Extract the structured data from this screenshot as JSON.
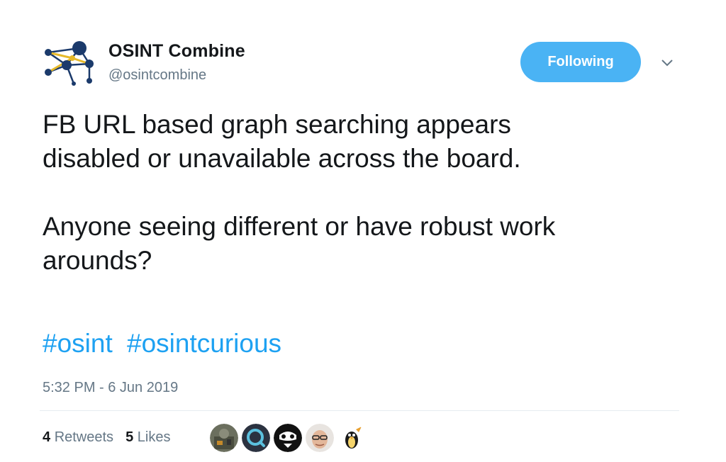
{
  "account": {
    "name": "OSINT Combine",
    "handle": "@osintcombine"
  },
  "follow_button": {
    "label": "Following",
    "color": "#4ab3f4"
  },
  "menu": {
    "icon": "chevron-down-icon"
  },
  "tweet": {
    "text": "FB URL based graph searching appears\ndisabled or unavailable across the board.\n\nAnyone seeing different or have robust work\narounds?",
    "hashtags": [
      "#osint",
      "#osintcurious"
    ],
    "timestamp": "5:32 PM - 6 Jun 2019"
  },
  "stats": {
    "retweets": {
      "count": "4",
      "label": "Retweets"
    },
    "likes": {
      "count": "5",
      "label": "Likes"
    }
  },
  "likers": [
    {
      "icon": "liker-avatar-camo"
    },
    {
      "icon": "liker-avatar-search"
    },
    {
      "icon": "liker-avatar-mask"
    },
    {
      "icon": "liker-avatar-face"
    },
    {
      "icon": "liker-avatar-penguin"
    }
  ],
  "colors": {
    "link": "#1da1f2",
    "muted": "#657786",
    "text": "#14171a"
  }
}
